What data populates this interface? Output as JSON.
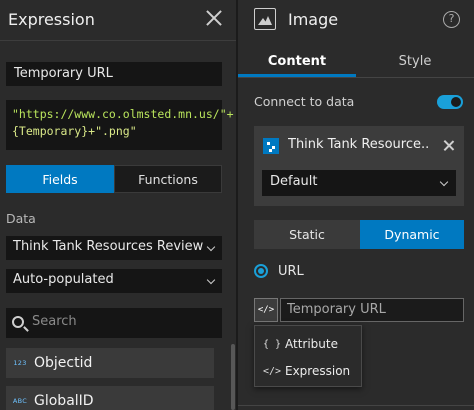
{
  "expression_panel": {
    "title": "Expression",
    "name_value": "Temporary URL",
    "code_line1": "\"https://www.co.olmsted.mn.us/\"+",
    "code_line2": "{Temporary}+\".png\"",
    "tabs": {
      "fields": "Fields",
      "functions": "Functions",
      "active": "Fields"
    },
    "data_label": "Data",
    "data_source_select": "Think Tank Resources Review",
    "population_select": "Auto-populated",
    "search_placeholder": "Search",
    "fields": [
      {
        "type_badge": "123",
        "name": "Objectid"
      },
      {
        "type_badge": "ABC",
        "name": "GlobalID"
      }
    ]
  },
  "image_panel": {
    "title": "Image",
    "help_glyph": "?",
    "tabs": {
      "content": "Content",
      "style": "Style",
      "active": "Content"
    },
    "connect_label": "Connect to data",
    "connect_enabled": true,
    "data_source": {
      "name": "Think Tank Resource...",
      "view": "Default"
    },
    "mode": {
      "static": "Static",
      "dynamic": "Dynamic",
      "active": "Dynamic"
    },
    "url_option": "URL",
    "code_button_glyph": "</>",
    "url_input_placeholder": "Temporary URL",
    "popup_menu": [
      {
        "icon": "{ }",
        "label": "Attribute"
      },
      {
        "icon": "</>",
        "label": "Expression"
      }
    ]
  },
  "colors": {
    "accent": "#0079c1",
    "toggle": "#1aa0d9",
    "panel_bg": "#2b2b2b",
    "input_bg": "#151515"
  }
}
